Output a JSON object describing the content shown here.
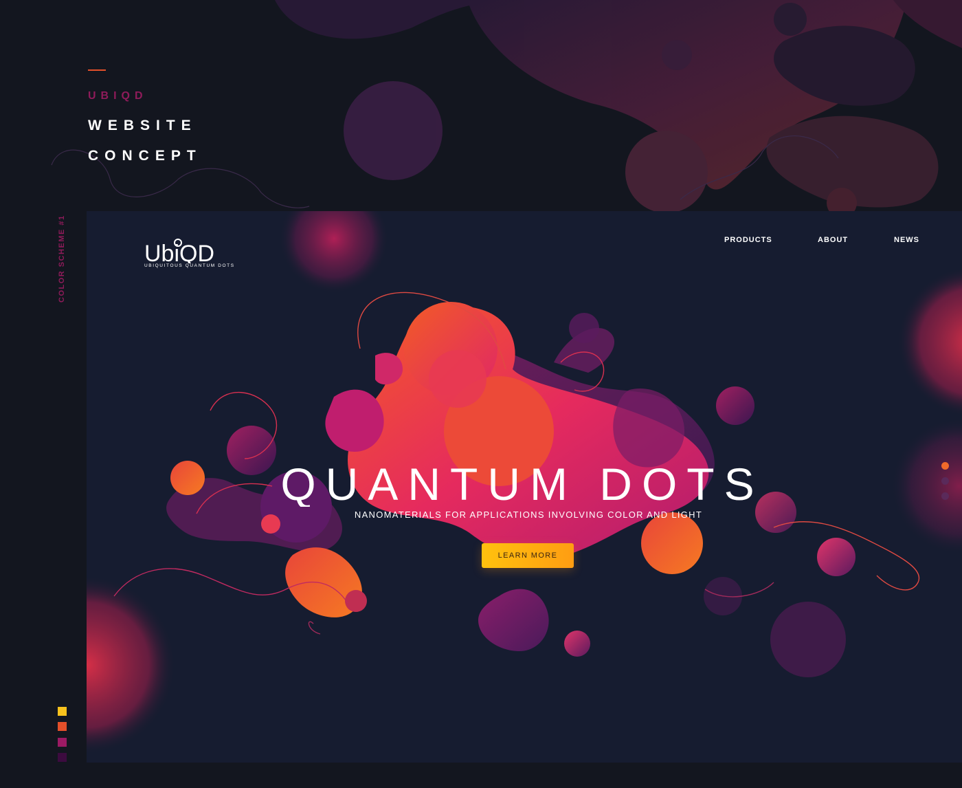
{
  "poster": {
    "brand": "UBIQD",
    "headline_line1": "WEBSITE",
    "headline_line2": "CONCEPT",
    "scheme_label": "COLOR SCHEME #1",
    "palette": [
      "#f8c21d",
      "#e4502a",
      "#9b1a63",
      "#3c0b3f"
    ]
  },
  "site": {
    "logo": {
      "wordmark": "UbiQD",
      "tagline": "UBIQUITOUS QUANTUM DOTS"
    },
    "nav": {
      "products": "PRODUCTS",
      "about": "ABOUT",
      "news": "NEWS"
    },
    "hero": {
      "title": "QUANTUM DOTS",
      "subtitle": "NANOMATERIALS FOR APPLICATIONS INVOLVING COLOR AND LIGHT",
      "cta": "LEARN MORE"
    },
    "slider": {
      "count": 3,
      "active_index": 0
    }
  },
  "colors": {
    "background": "#13161f",
    "mockup_bg": "#161c30",
    "accent_orange": "#f06a2a",
    "accent_magenta": "#d6206b",
    "accent_purple": "#5a1a5e",
    "button_yellow": "#ffc10e"
  }
}
